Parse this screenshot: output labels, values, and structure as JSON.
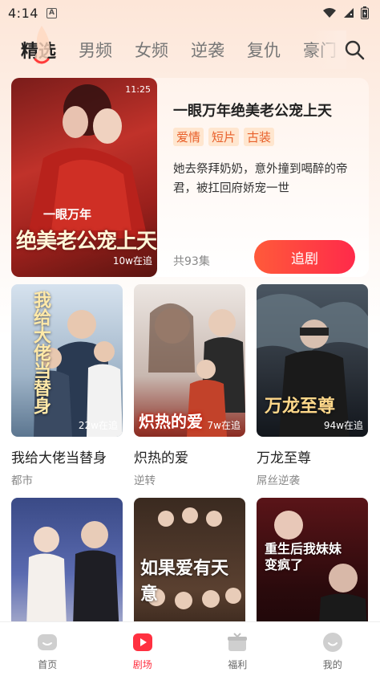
{
  "status": {
    "time": "4:14",
    "notification_badge": "A"
  },
  "tabs": [
    {
      "label": "精选",
      "active": true
    },
    {
      "label": "男频",
      "active": false
    },
    {
      "label": "女频",
      "active": false
    },
    {
      "label": "逆袭",
      "active": false
    },
    {
      "label": "复仇",
      "active": false
    },
    {
      "label": "豪门",
      "active": false
    }
  ],
  "featured": {
    "title": "一眼万年绝美老公宠上天",
    "tags": [
      "爱情",
      "短片",
      "古装"
    ],
    "description": "她去祭拜奶奶，意外撞到喝醉的帝君，被扛回府娇宠一世",
    "episodes": "共93集",
    "follow_label": "追剧",
    "poster": {
      "duration": "11:25",
      "calligraphy_top": "一眼万年",
      "calligraphy_main": "绝美老公宠上天",
      "views": "10w在追"
    }
  },
  "cards": [
    {
      "title": "我给大佬当替身",
      "genre": "都市",
      "views": "22w在追",
      "calligraphy": "我给大佬当替身",
      "icon": "poster-image"
    },
    {
      "title": "炽热的爱",
      "genre": "逆转",
      "views": "7w在追",
      "calligraphy": "炽热的爱",
      "icon": "poster-image"
    },
    {
      "title": "万龙至尊",
      "genre": "屌丝逆袭",
      "views": "94w在追",
      "calligraphy": "万龙至尊",
      "icon": "poster-image"
    },
    {
      "title": "",
      "genre": "",
      "views": "",
      "calligraphy": "",
      "icon": "poster-image"
    },
    {
      "title": "",
      "genre": "",
      "views": "",
      "calligraphy": "如果爱有天意",
      "icon": "poster-image"
    },
    {
      "title": "",
      "genre": "",
      "views": "",
      "calligraphy": "重生后我妹妹变疯了",
      "icon": "poster-image"
    }
  ],
  "bottom_nav": [
    {
      "label": "首页",
      "icon": "home-icon",
      "active": false
    },
    {
      "label": "剧场",
      "icon": "theater-icon",
      "active": true
    },
    {
      "label": "福利",
      "icon": "gift-icon",
      "active": false
    },
    {
      "label": "我的",
      "icon": "profile-icon",
      "active": false
    }
  ],
  "colors": {
    "accent": "#ff3040",
    "tag_text": "#e8602b",
    "tag_bg": "#ffe6cf"
  }
}
